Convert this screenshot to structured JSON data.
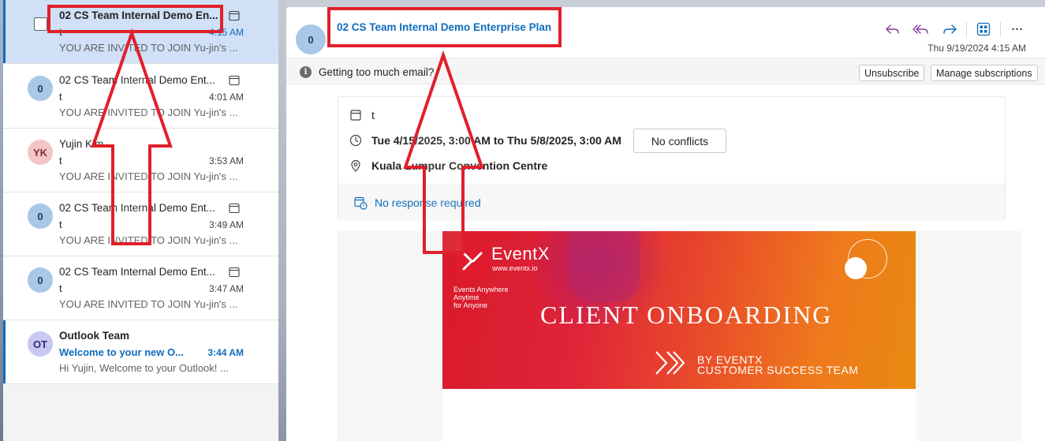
{
  "colors": {
    "accent": "#0f6cbd",
    "selected_row": "#cfe0f7",
    "annotation_red": "#e0202a"
  },
  "messages": [
    {
      "sender": "02 CS Team Internal Demo En...",
      "subject": "t",
      "time": "4:15 AM",
      "preview": "YOU ARE INVITED TO JOIN Yu-jin's ...",
      "avatar": "",
      "selected": true,
      "unread": false,
      "icon": "calendar-icon"
    },
    {
      "sender": "02 CS Team Internal Demo Ent...",
      "subject": "t",
      "time": "4:01 AM",
      "preview": "YOU ARE INVITED TO JOIN Yu-jin's ...",
      "avatar": "0",
      "icon": "calendar-icon"
    },
    {
      "sender": "Yujin Kim",
      "subject": "t",
      "time": "3:53 AM",
      "preview": "YOU ARE INVITED TO JOIN Yu-jin's ...",
      "avatar": "YK",
      "icon": ""
    },
    {
      "sender": "02 CS Team Internal Demo Ent...",
      "subject": "t",
      "time": "3:49 AM",
      "preview": "YOU ARE INVITED TO JOIN Yu-jin's ...",
      "avatar": "0",
      "icon": "calendar-icon"
    },
    {
      "sender": "02 CS Team Internal Demo Ent...",
      "subject": "t",
      "time": "3:47 AM",
      "preview": "YOU ARE INVITED TO JOIN Yu-jin's ...",
      "avatar": "0",
      "icon": "calendar-icon"
    },
    {
      "sender": "Outlook Team",
      "subject": "Welcome to your new O...",
      "time": "3:44 AM",
      "preview": "Hi Yujin, Welcome to your Outlook! ...",
      "avatar": "OT",
      "unread": true,
      "icon": ""
    }
  ],
  "reading_pane": {
    "avatar": "0",
    "title": "02 CS Team Internal Demo Enterprise Plan",
    "date": "Thu 9/19/2024 4:15 AM",
    "actions": [
      "reply-icon",
      "reply-all-icon",
      "forward-icon",
      "apps-icon",
      "more-icon"
    ],
    "more_label": "···",
    "notice": "Getting too much email?",
    "unsubscribe_label": "Unsubscribe",
    "manage_label": "Manage subscriptions",
    "meeting": {
      "title": "t",
      "when": "Tue 4/15/2025, 3:00 AM to Thu 5/8/2025, 3:00 AM",
      "conflicts_label": "No conflicts",
      "location": "Kuala Lumpur Convention Centre",
      "response": "No response required"
    },
    "banner": {
      "brand": "EventX",
      "url": "www.eventx.io",
      "tagline_lines": [
        "Events Anywhere",
        "Anytime",
        "for Anyone"
      ],
      "headline": "CLIENT ONBOARDING",
      "by_lines": [
        "BY EVENTX",
        "CUSTOMER SUCCESS TEAM"
      ]
    }
  }
}
